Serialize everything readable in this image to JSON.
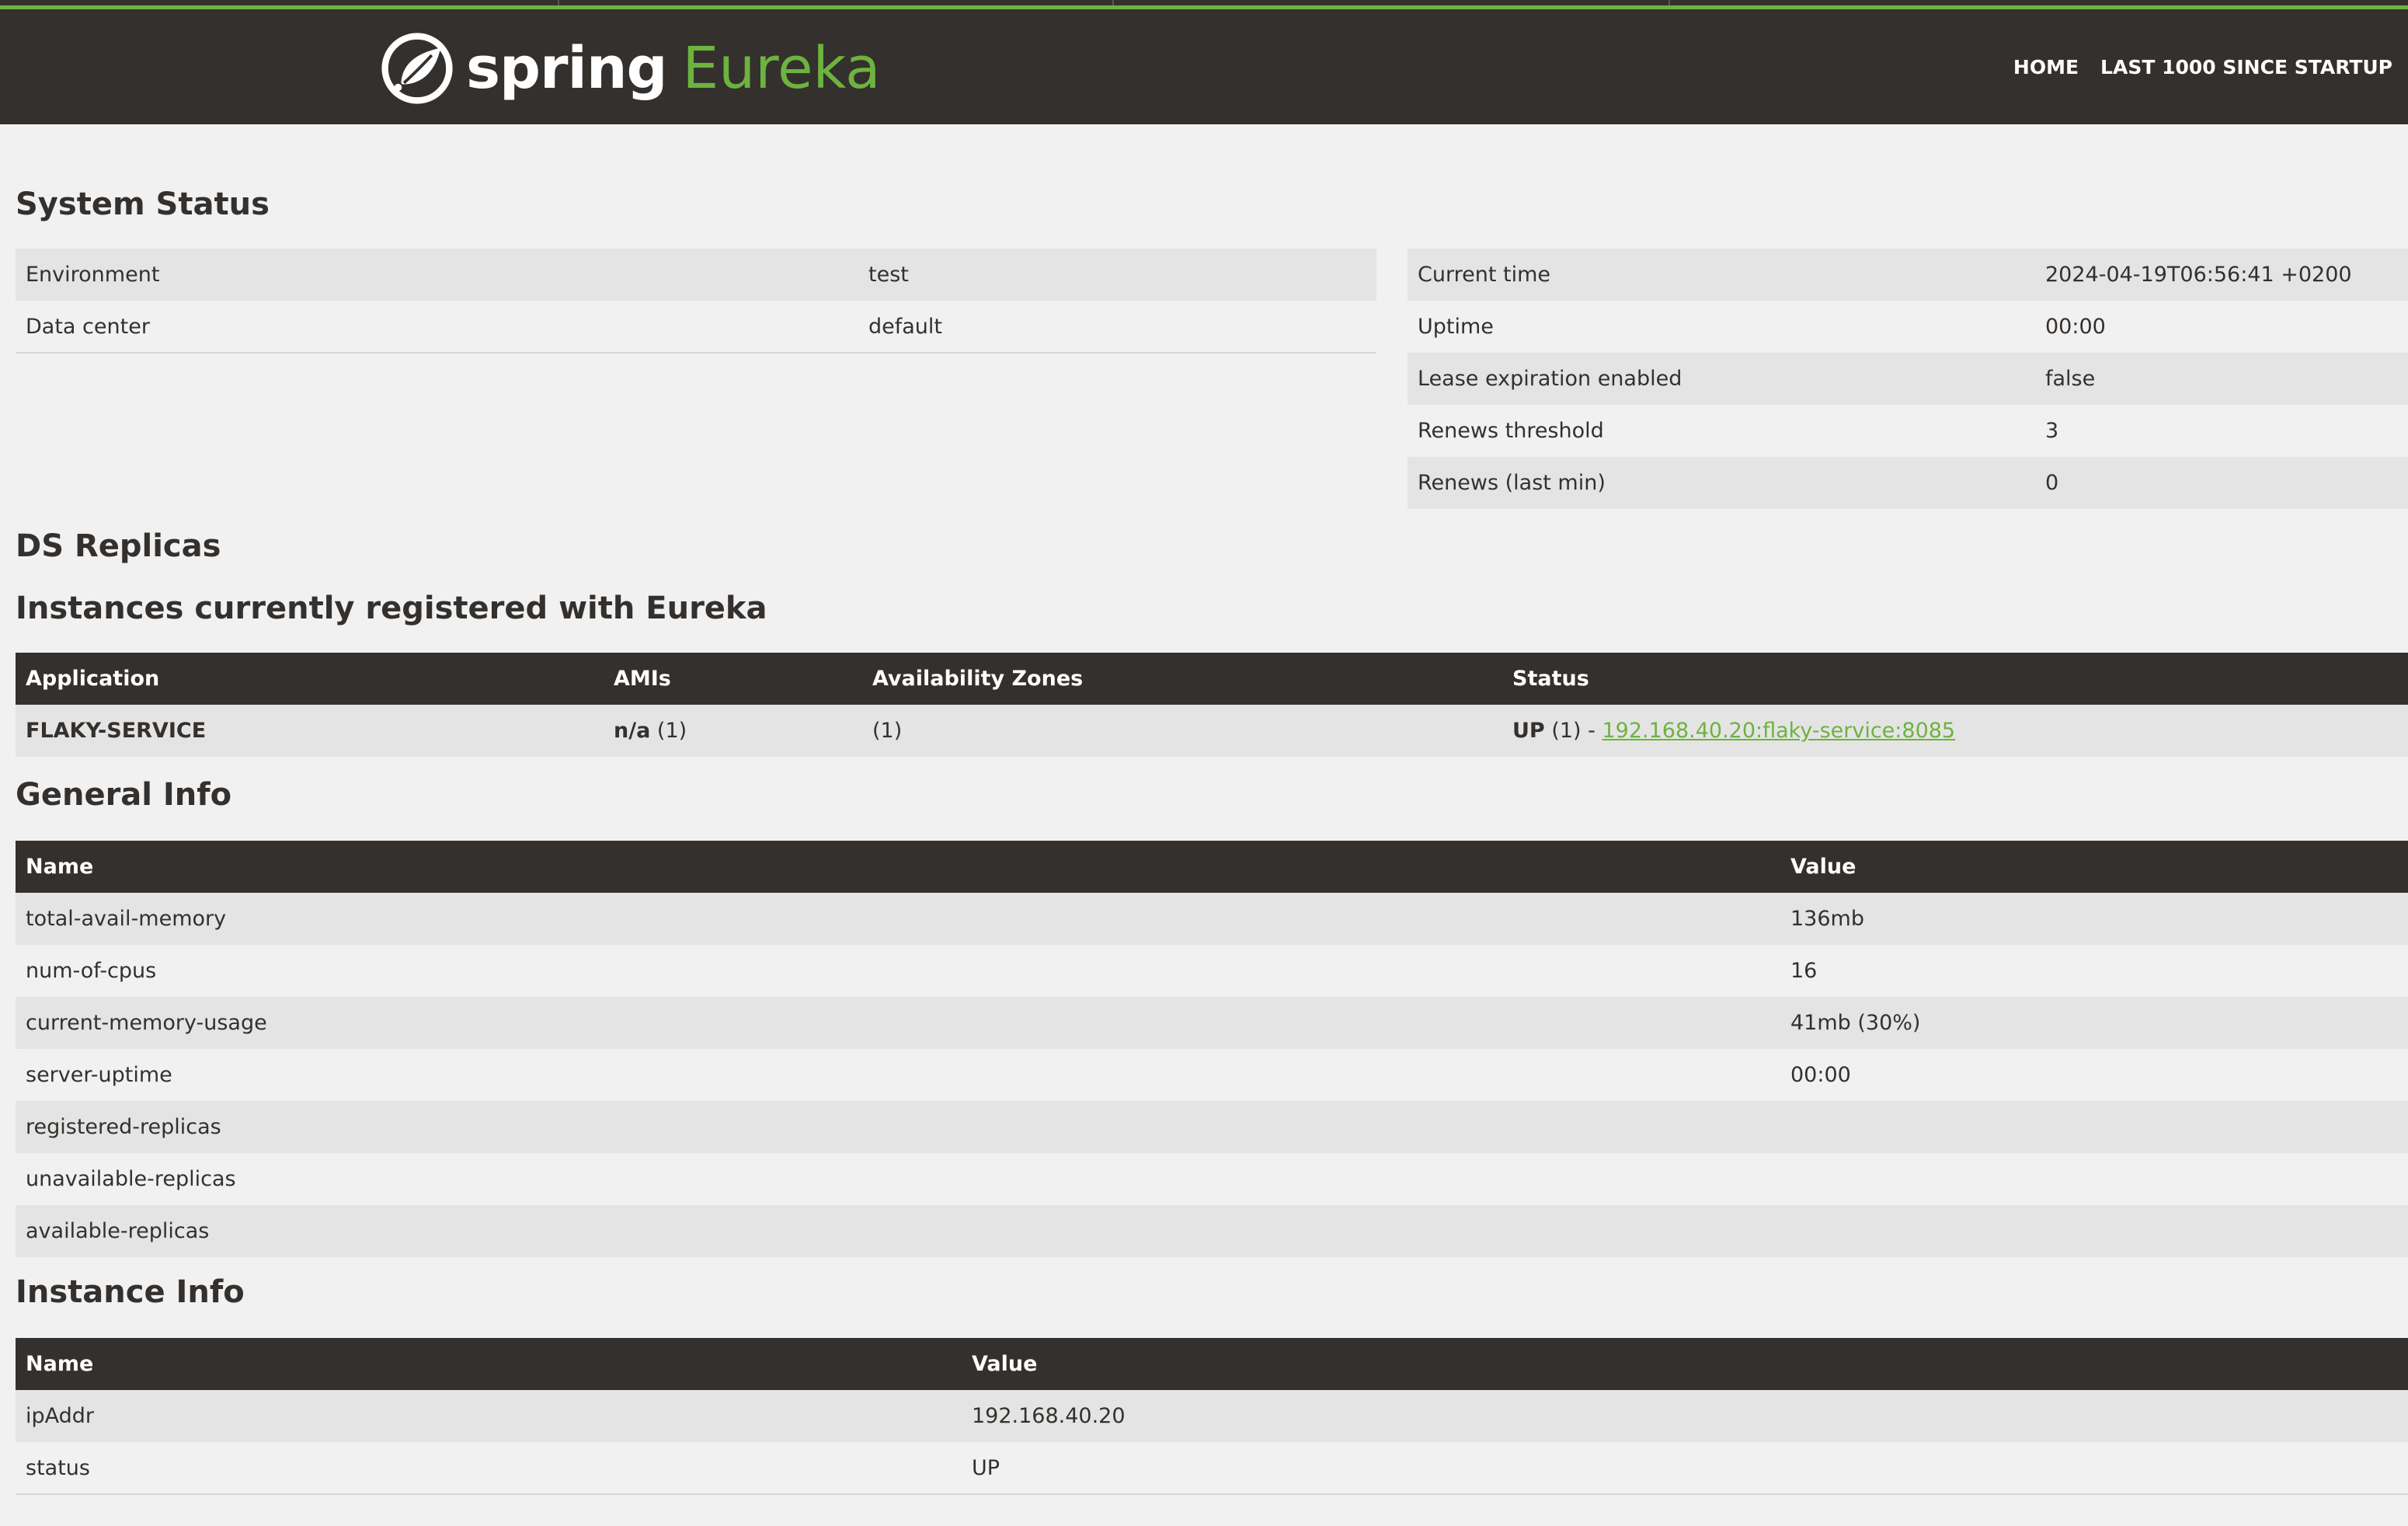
{
  "brand": {
    "spring": "spring",
    "eureka": "Eureka"
  },
  "nav": {
    "home": "HOME",
    "last1000": "LAST 1000 SINCE STARTUP"
  },
  "system_status": {
    "title": "System Status",
    "left": [
      {
        "label": "Environment",
        "value": "test"
      },
      {
        "label": "Data center",
        "value": "default"
      }
    ],
    "right": [
      {
        "label": "Current time",
        "value": "2024-04-19T06:56:41 +0200"
      },
      {
        "label": "Uptime",
        "value": "00:00"
      },
      {
        "label": "Lease expiration enabled",
        "value": "false"
      },
      {
        "label": "Renews threshold",
        "value": "3"
      },
      {
        "label": "Renews (last min)",
        "value": "0"
      }
    ]
  },
  "ds_replicas": {
    "title": "DS Replicas"
  },
  "instances": {
    "title": "Instances currently registered with Eureka",
    "headers": [
      "Application",
      "AMIs",
      "Availability Zones",
      "Status"
    ],
    "rows": [
      {
        "application": "FLAKY-SERVICE",
        "ami_name": "n/a",
        "ami_count": "(1)",
        "zones": "(1)",
        "status": "UP",
        "status_count": "(1) -",
        "instance_link": "192.168.40.20:flaky-service:8085"
      }
    ]
  },
  "general_info": {
    "title": "General Info",
    "headers": [
      "Name",
      "Value"
    ],
    "rows": [
      {
        "name": "total-avail-memory",
        "value": "136mb"
      },
      {
        "name": "num-of-cpus",
        "value": "16"
      },
      {
        "name": "current-memory-usage",
        "value": "41mb (30%)"
      },
      {
        "name": "server-uptime",
        "value": "00:00"
      },
      {
        "name": "registered-replicas",
        "value": ""
      },
      {
        "name": "unavailable-replicas",
        "value": ""
      },
      {
        "name": "available-replicas",
        "value": ""
      }
    ]
  },
  "instance_info": {
    "title": "Instance Info",
    "headers": [
      "Name",
      "Value"
    ],
    "rows": [
      {
        "name": "ipAddr",
        "value": "192.168.40.20"
      },
      {
        "name": "status",
        "value": "UP"
      }
    ]
  },
  "colors": {
    "header_bg": "#34302d",
    "accent_green": "#6db33f",
    "page_bg": "#f1f1f1",
    "row_alt": "#e4e4e4"
  }
}
